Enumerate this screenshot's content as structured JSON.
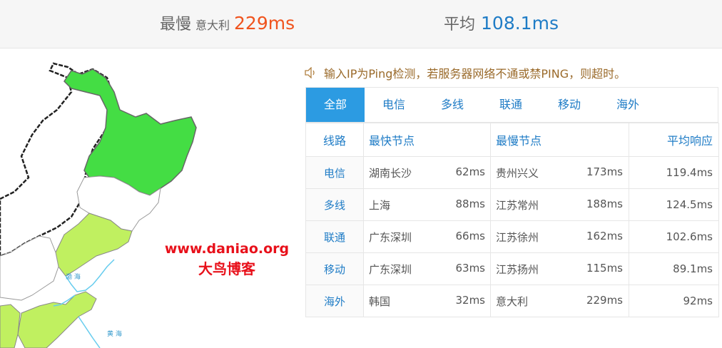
{
  "summary": {
    "slowest_label": "最慢",
    "slowest_location": "意大利",
    "slowest_value": "229ms",
    "average_label": "平均",
    "average_value": "108.1ms"
  },
  "watermark": {
    "url": "www.daniao.org",
    "name": "大鸟博客"
  },
  "map": {
    "sea_label_1": "渤 海",
    "sea_label_2": "黄 海",
    "colors": {
      "heilongjiang": "#44dd44",
      "liaoning": "#c0f060",
      "jilin": "#ffffff",
      "sea_line": "#66ccee"
    }
  },
  "notice": {
    "icon": "speaker-icon",
    "text": "输入IP为Ping检测，若服务器网络不通或禁PING，则超时。"
  },
  "tabs": [
    {
      "label": "全部",
      "active": true
    },
    {
      "label": "电信",
      "active": false
    },
    {
      "label": "多线",
      "active": false
    },
    {
      "label": "联通",
      "active": false
    },
    {
      "label": "移动",
      "active": false
    },
    {
      "label": "海外",
      "active": false
    }
  ],
  "table": {
    "headers": {
      "line": "线路",
      "fastest": "最快节点",
      "slowest": "最慢节点",
      "average": "平均响应"
    },
    "rows": [
      {
        "line": "电信",
        "fast_node": "湖南长沙",
        "fast_ms": "62ms",
        "slow_node": "贵州兴义",
        "slow_ms": "173ms",
        "avg": "119.4ms"
      },
      {
        "line": "多线",
        "fast_node": "上海",
        "fast_ms": "88ms",
        "slow_node": "江苏常州",
        "slow_ms": "188ms",
        "avg": "124.5ms"
      },
      {
        "line": "联通",
        "fast_node": "广东深圳",
        "fast_ms": "66ms",
        "slow_node": "江苏徐州",
        "slow_ms": "162ms",
        "avg": "102.6ms"
      },
      {
        "line": "移动",
        "fast_node": "广东深圳",
        "fast_ms": "63ms",
        "slow_node": "江苏扬州",
        "slow_ms": "115ms",
        "avg": "89.1ms"
      },
      {
        "line": "海外",
        "fast_node": "韩国",
        "fast_ms": "32ms",
        "slow_node": "意大利",
        "slow_ms": "229ms",
        "avg": "92ms"
      }
    ]
  },
  "colors": {
    "accent_blue": "#1f7cc6",
    "tab_active": "#2c9be2",
    "slow_red": "#f0541e",
    "notice_brown": "#9a6a2a",
    "watermark_red": "#e8101a"
  }
}
